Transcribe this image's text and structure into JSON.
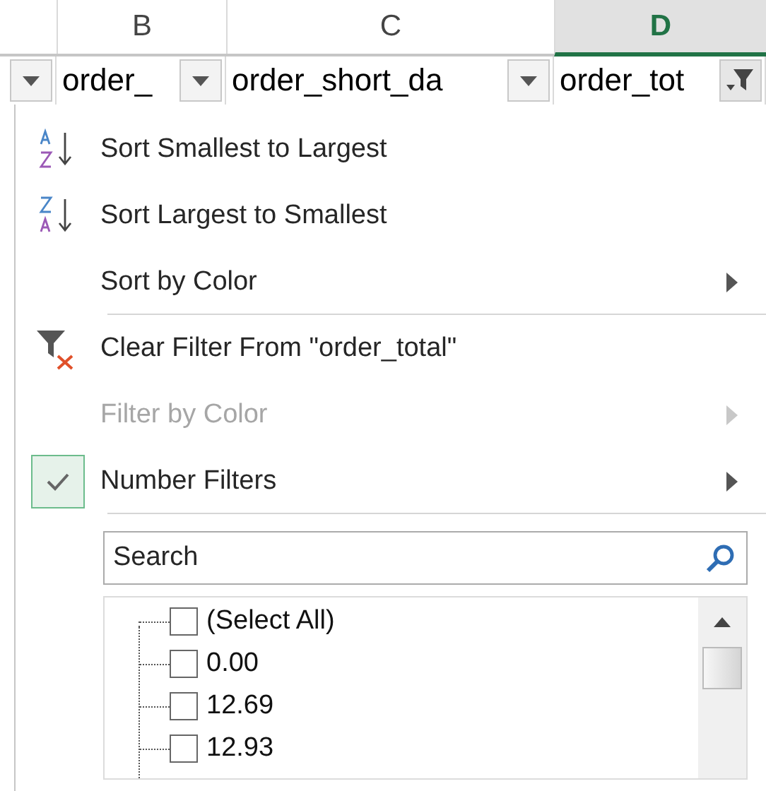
{
  "columns": [
    {
      "letter": "B",
      "selected": false
    },
    {
      "letter": "C",
      "selected": false
    },
    {
      "letter": "D",
      "selected": true
    }
  ],
  "header_cells": [
    {
      "text": "order_",
      "filtered": false
    },
    {
      "text": "order_short_da",
      "filtered": false
    },
    {
      "text": "order_tot",
      "filtered": true
    }
  ],
  "menu": {
    "items": [
      {
        "kind": "sort_ascending",
        "label": "Sort Smallest to Largest",
        "disabled": false,
        "submenu": false,
        "checked": false,
        "separator_after": false
      },
      {
        "kind": "sort_descending",
        "label": "Sort Largest to Smallest",
        "disabled": false,
        "submenu": false,
        "checked": false,
        "separator_after": false
      },
      {
        "kind": "plain",
        "label": "Sort by Color",
        "disabled": false,
        "submenu": true,
        "checked": false,
        "separator_after": true
      },
      {
        "kind": "clear_filter",
        "label": "Clear Filter From \"order_total\"",
        "disabled": false,
        "submenu": false,
        "checked": false,
        "separator_after": false
      },
      {
        "kind": "plain",
        "label": "Filter by Color",
        "disabled": true,
        "submenu": true,
        "checked": false,
        "separator_after": false
      },
      {
        "kind": "plain",
        "label": "Number Filters",
        "disabled": false,
        "submenu": true,
        "checked": true,
        "separator_after": true
      }
    ],
    "search": {
      "placeholder": "Search"
    },
    "values": [
      {
        "label": "(Select All)",
        "checked": false
      },
      {
        "label": "0.00",
        "checked": false
      },
      {
        "label": "12.69",
        "checked": false
      },
      {
        "label": "12.93",
        "checked": false
      }
    ]
  }
}
